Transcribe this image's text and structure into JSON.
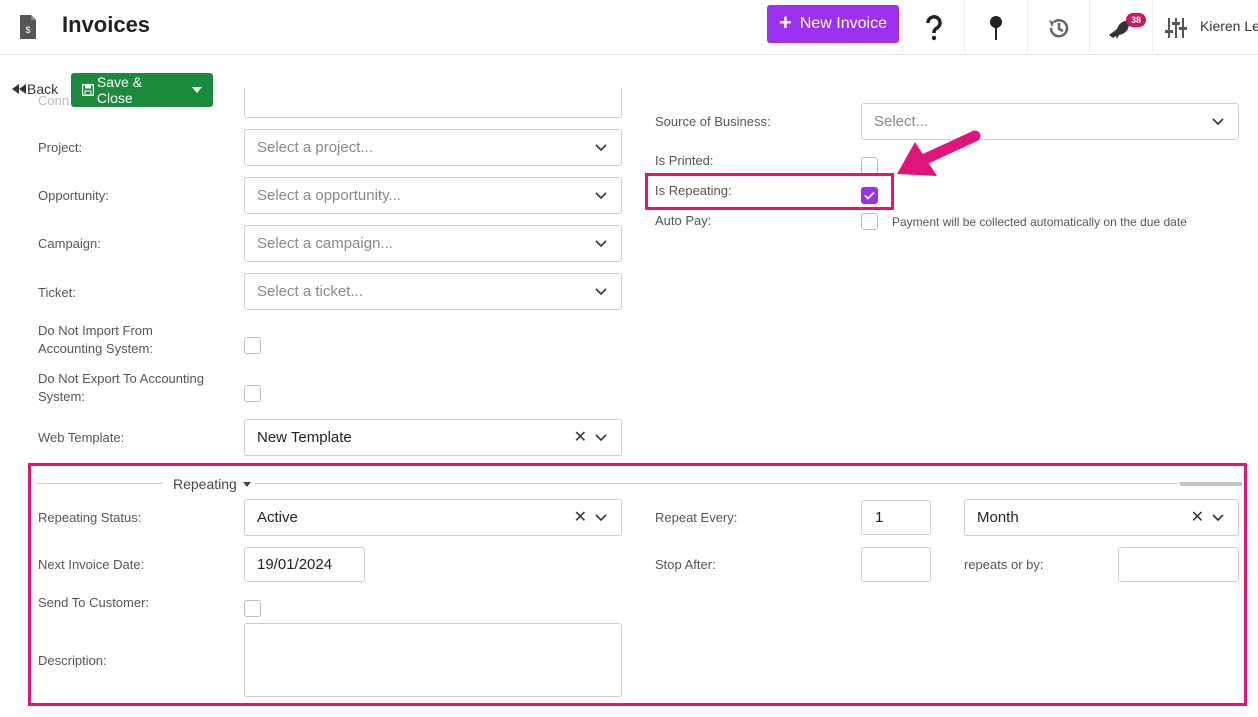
{
  "header": {
    "title": "Invoices",
    "new_invoice_label": "New Invoice",
    "notification_count": "38",
    "user_name": "Kieren Le"
  },
  "actions": {
    "back_label": "Back",
    "save_close_label": "Save & Close"
  },
  "left": {
    "project_label": "Project:",
    "project_placeholder": "Select a project...",
    "opportunity_label": "Opportunity:",
    "opportunity_placeholder": "Select a opportunity...",
    "campaign_label": "Campaign:",
    "campaign_placeholder": "Select a campaign...",
    "ticket_label": "Ticket:",
    "ticket_placeholder": "Select a ticket...",
    "no_import_label": "Do Not Import From Accounting System:",
    "no_export_label": "Do Not Export To Accounting System:",
    "web_template_label": "Web Template:",
    "web_template_value": "New Template"
  },
  "right": {
    "source_label": "Source of Business:",
    "source_placeholder": "Select...",
    "is_printed_label": "Is Printed:",
    "is_repeating_label": "Is Repeating:",
    "auto_pay_label": "Auto Pay:",
    "auto_pay_hint": "Payment will be collected automatically on the due date"
  },
  "repeating": {
    "section_title": "Repeating",
    "status_label": "Repeating Status:",
    "status_value": "Active",
    "next_date_label": "Next Invoice Date:",
    "next_date_value": "19/01/2024",
    "send_label": "Send To Customer:",
    "description_label": "Description:",
    "repeat_every_label": "Repeat Every:",
    "repeat_every_value": "1",
    "repeat_unit_value": "Month",
    "stop_after_label": "Stop After:",
    "repeats_or_by_label": "repeats or by:"
  },
  "colors": {
    "accent": "#9b30ef",
    "save_green": "#1b8a3d",
    "highlight": "#e0157a",
    "badge": "#c8175d"
  }
}
